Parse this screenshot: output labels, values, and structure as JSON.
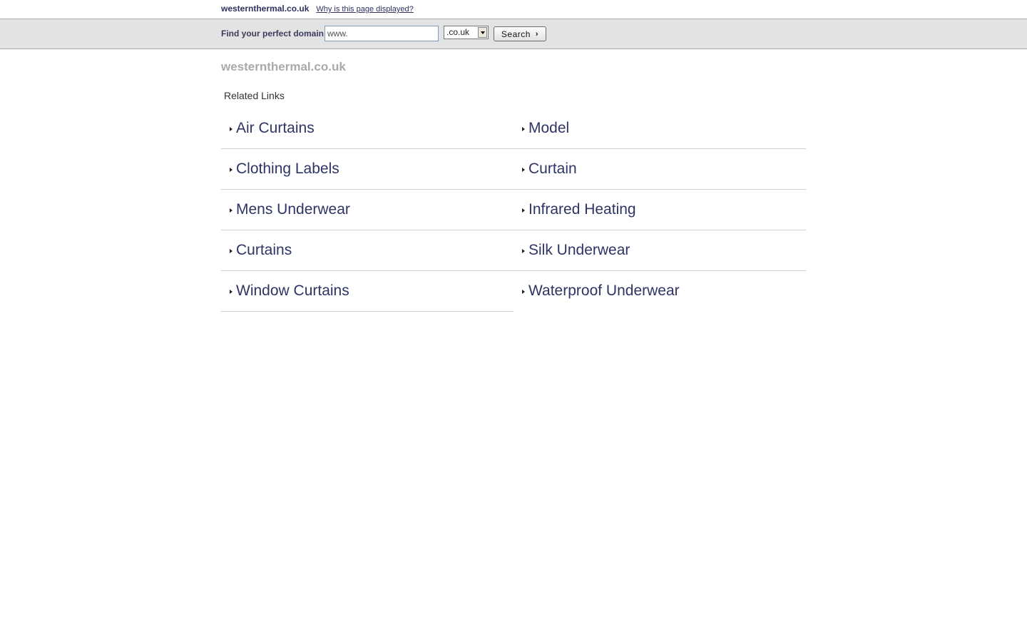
{
  "header": {
    "site_name": "westernthermal.co.uk",
    "why_link": "Why is this page displayed?"
  },
  "search": {
    "label": "Find your perfect domain",
    "input_value": "www.",
    "tld_selected": ".co.uk",
    "button_label": "Search"
  },
  "main": {
    "headline": "westernthermal.co.uk",
    "related_heading": "Related Links",
    "links": [
      "Air Curtains",
      "Model",
      "Clothing Labels",
      "Curtain",
      "Mens Underwear",
      "Infrared Heating",
      "Curtains",
      "Silk Underwear",
      "Window Curtains",
      "Waterproof Underwear"
    ]
  },
  "colors": {
    "link": "#2e3464",
    "bar_background": "#e3e3e3",
    "headline": "#aaaaaa"
  }
}
